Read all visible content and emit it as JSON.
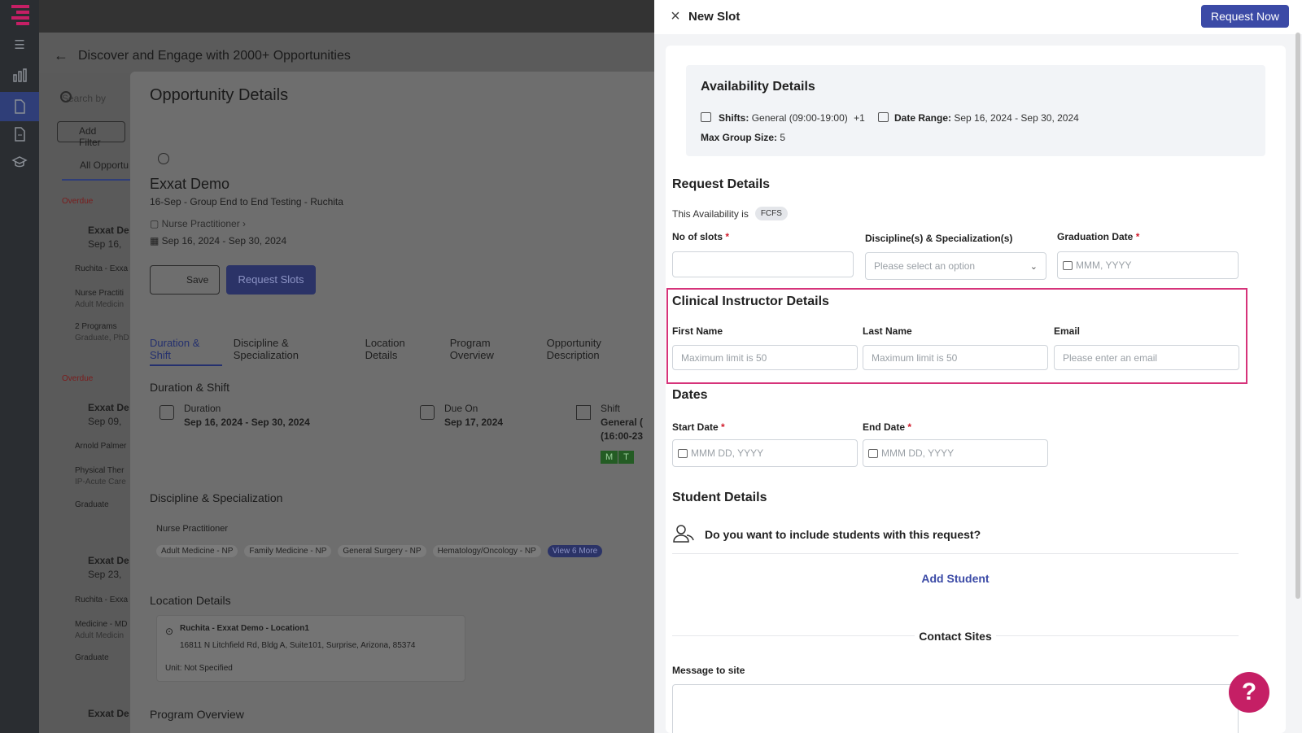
{
  "background": {
    "page_title": "Discover and Engage with 2000+ Opportunities",
    "search_placeholder": "Search by",
    "add_filter": "Add Filter",
    "tab_all": "All Opportu",
    "list_items": [
      {
        "status": "Overdue",
        "name": "Exxat De",
        "date": "Sep 16,",
        "loc": "Ruchita - Exxa",
        "prog": "Nurse Practiti",
        "prog2": "Adult Medicin",
        "programs": "2 Programs",
        "programs2": "Graduate, PhD"
      },
      {
        "status": "Overdue",
        "name": "Exxat De",
        "date": "Sep 09,",
        "loc": "Arnold Palmer",
        "prog": "Physical Ther",
        "prog2": "IP-Acute Care",
        "programs": "Graduate"
      },
      {
        "name": "Exxat De",
        "date": "Sep 23,",
        "loc": "Ruchita - Exxa",
        "prog": "Medicine - MD",
        "prog2": "Adult Medicin",
        "programs": "Graduate"
      },
      {
        "name": "Exxat De"
      }
    ],
    "details": {
      "title": "Opportunity Details",
      "org": "Exxat Demo",
      "subtitle": "16-Sep - Group End to End Testing - Ruchita",
      "program": "Nurse Practitioner",
      "date_range": "Sep 16, 2024 - Sep 30, 2024",
      "save": "Save",
      "request_slots": "Request Slots",
      "tabs": [
        "Duration & Shift",
        "Discipline & Specialization",
        "Location Details",
        "Program Overview",
        "Opportunity Description"
      ],
      "section_duration": "Duration & Shift",
      "duration_label": "Duration",
      "duration_value": "Sep 16, 2024 - Sep 30, 2024",
      "due_label": "Due On",
      "due_value": "Sep 17, 2024",
      "shift_label": "Shift",
      "shift_value": "General (",
      "shift_value2": "(16:00-23",
      "days": [
        "M",
        "T"
      ],
      "section_discipline": "Discipline & Specialization",
      "discipline": "Nurse Practitioner",
      "specs": [
        "Adult Medicine - NP",
        "Family Medicine - NP",
        "General Surgery - NP",
        "Hematology/Oncology - NP"
      ],
      "view_more": "View 6 More",
      "section_location": "Location Details",
      "loc_name": "Ruchita - Exxat Demo - Location1",
      "loc_address": "16811 N Litchfield Rd, Bldg A, Suite101, Surprise, Arizona, 85374",
      "loc_unit": "Unit: Not Specified",
      "section_program": "Program Overview"
    }
  },
  "drawer": {
    "title": "New Slot",
    "request_now": "Request Now",
    "availability": {
      "heading": "Availability Details",
      "shifts_label": "Shifts:",
      "shifts_value": "General (09:00-19:00)",
      "shifts_more": "+1",
      "date_range_label": "Date Range:",
      "date_range_value": "Sep 16, 2024 - Sep 30, 2024",
      "group_label": "Max Group Size:",
      "group_value": "5"
    },
    "request": {
      "heading": "Request Details",
      "availability_text": "This Availability is",
      "badge": "FCFS",
      "slots_label": "No of slots",
      "discipline_label": "Discipline(s) & Specialization(s)",
      "discipline_placeholder": "Please select an option",
      "grad_label": "Graduation Date",
      "grad_placeholder": "MMM, YYYY"
    },
    "instructor": {
      "heading": "Clinical Instructor Details",
      "first_label": "First Name",
      "first_placeholder": "Maximum limit is 50",
      "last_label": "Last Name",
      "last_placeholder": "Maximum limit is 50",
      "email_label": "Email",
      "email_placeholder": "Please enter an email"
    },
    "dates": {
      "heading": "Dates",
      "start_label": "Start Date",
      "start_placeholder": "MMM DD, YYYY",
      "end_label": "End Date",
      "end_placeholder": "MMM DD, YYYY"
    },
    "students": {
      "heading": "Student Details",
      "question": "Do you want to include students with this request?",
      "add": "Add Student"
    },
    "contact": {
      "heading": "Contact Sites",
      "message_label": "Message to site"
    }
  },
  "colors": {
    "primary": "#3b4aa6",
    "highlight": "#d6337a",
    "help": "#c51f65",
    "required": "#d11a2a"
  }
}
